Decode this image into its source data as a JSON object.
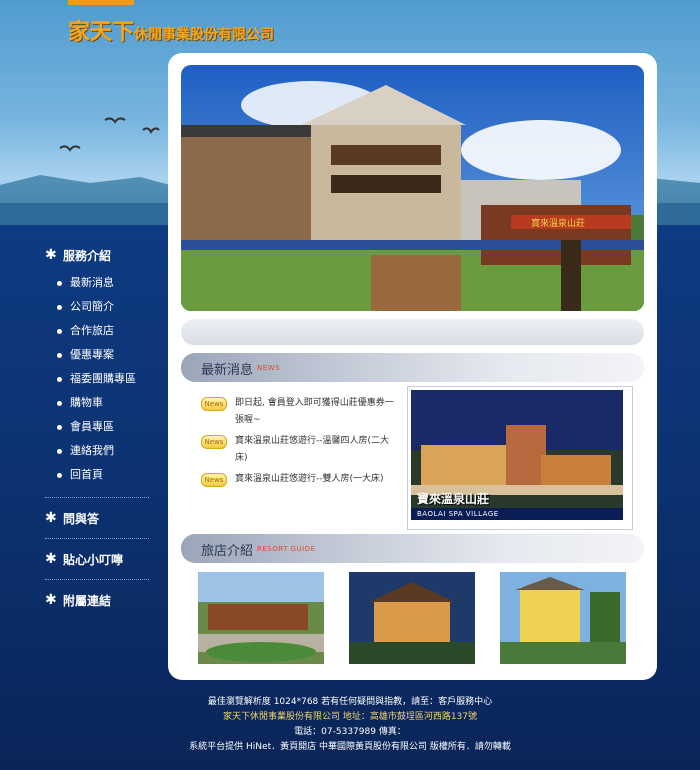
{
  "brand": {
    "name_big": "家天下",
    "name_small": "休閒事業股份有限公司"
  },
  "sidebar": {
    "service_header": "服務介紹",
    "items": [
      {
        "label": "最新消息"
      },
      {
        "label": "公司簡介"
      },
      {
        "label": "合作旅店"
      },
      {
        "label": "優惠專案"
      },
      {
        "label": "福委團購專區"
      },
      {
        "label": "購物車"
      },
      {
        "label": "會員專區"
      },
      {
        "label": "連絡我們"
      },
      {
        "label": "回首頁"
      }
    ],
    "qa_header": "問與答",
    "tips_header": "貼心小叮嚀",
    "links_header": "附屬連結"
  },
  "news": {
    "title": "最新消息",
    "subtitle": "NEWS",
    "badge": "News",
    "items": [
      {
        "text": "即日起, 會員登入即可獲得山莊優惠券一張喔~"
      },
      {
        "text": "寶來溫泉山莊悠遊行--溫馨四人房(二大床)"
      },
      {
        "text": "寶來溫泉山莊悠遊行--雙人房(一大床)"
      }
    ],
    "feature_caption_zh": "寶來溫泉山莊",
    "feature_caption_en": "BAOLAI SPA VILLAGE"
  },
  "resorts": {
    "title": "旅店介紹",
    "subtitle": "RESORT GUIDE"
  },
  "hero": {
    "sign_text": "寶來溫泉山莊"
  },
  "footer": {
    "line1": "最佳瀏覽解析度 1024*768 若有任何疑問與指教，請至：客戶服務中心",
    "line2": "家天下休閒事業股份有限公司    地址：高雄市鼓埕區河西路137號",
    "line3": "電話：07-5337989 傳真：",
    "line4": "系統平台提供 HiNet．黃頁開店    中華國際黃頁股份有限公司 版權所有．請勿轉載"
  }
}
